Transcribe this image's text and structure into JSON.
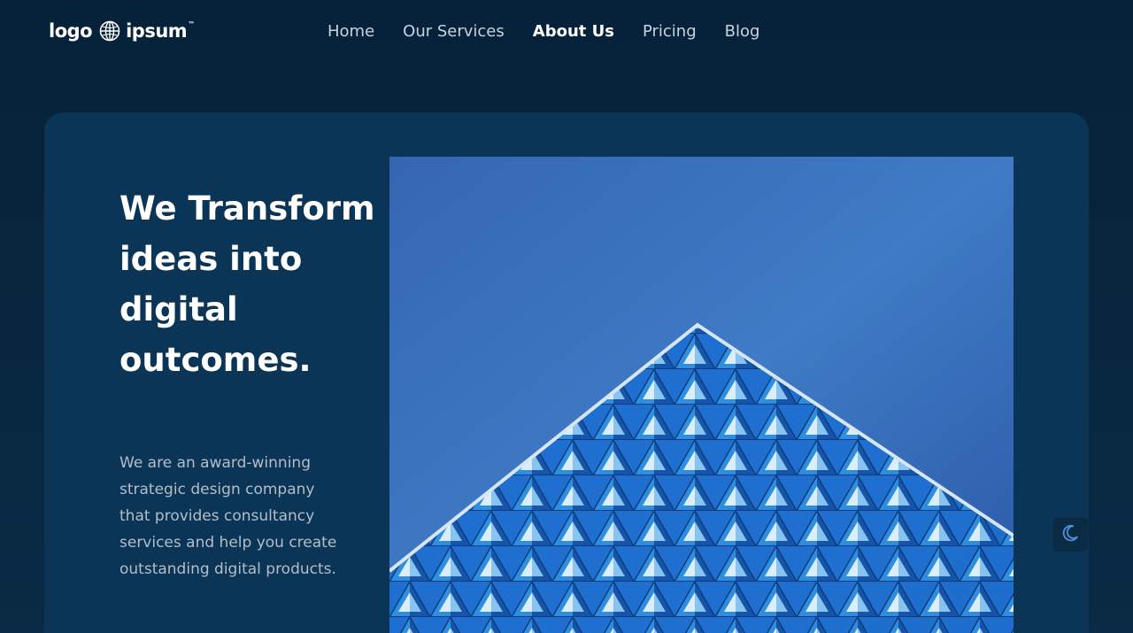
{
  "header": {
    "logo": {
      "left_word": "logo",
      "right_word": "ipsum",
      "trademark": "™",
      "icon": "globe-icon"
    },
    "nav": [
      {
        "label": "Home",
        "active": false
      },
      {
        "label": "Our Services",
        "active": false
      },
      {
        "label": "About Us",
        "active": true
      },
      {
        "label": "Pricing",
        "active": false
      },
      {
        "label": "Blog",
        "active": false
      }
    ]
  },
  "hero": {
    "headline": "We Transform ideas into digital outcomes.",
    "description": "We are an award-winning strategic design company that provides consultancy services and help you create outstanding digital products.",
    "image": {
      "subject": "blue triangular building facade against sky",
      "icon": "hero-photo"
    }
  },
  "theme_toggle": {
    "icon": "moon-icon"
  },
  "colors": {
    "background": "#062239",
    "card": "#0b3556",
    "nav_text": "#c9d3dc",
    "nav_active": "#ffffff",
    "body_text": "#b3bec8",
    "accent": "#4a90d9"
  }
}
